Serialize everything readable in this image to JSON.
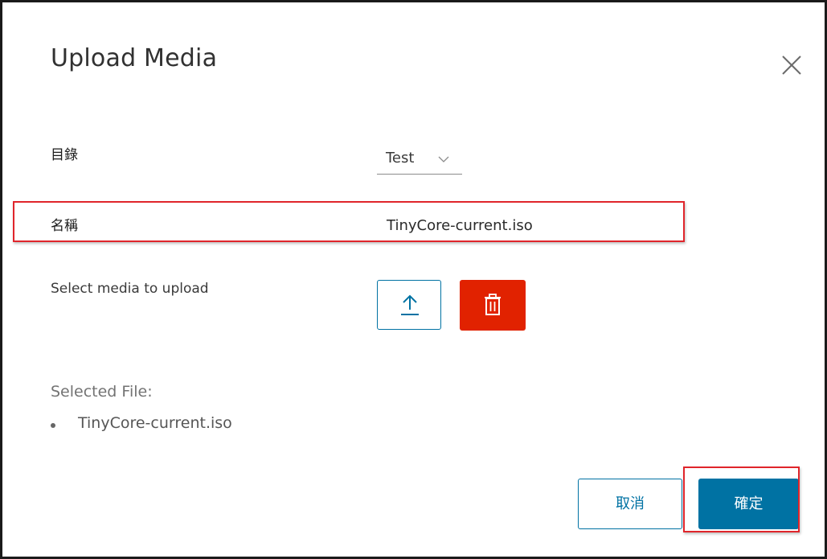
{
  "dialog": {
    "title": "Upload Media",
    "close_icon": "close-icon"
  },
  "form": {
    "directory_label": "目錄",
    "directory_value": "Test",
    "directory_icon": "chevron-down-icon",
    "name_label": "名稱",
    "name_value": "TinyCore-current.iso",
    "select_media_label": "Select media to upload",
    "upload_icon": "upload-icon",
    "delete_icon": "trash-icon"
  },
  "selected": {
    "title": "Selected File:",
    "files": [
      "TinyCore-current.iso"
    ]
  },
  "footer": {
    "cancel_label": "取消",
    "confirm_label": "確定"
  },
  "colors": {
    "primary": "#0072a3",
    "danger": "#e12200",
    "highlight": "#e0252b"
  }
}
